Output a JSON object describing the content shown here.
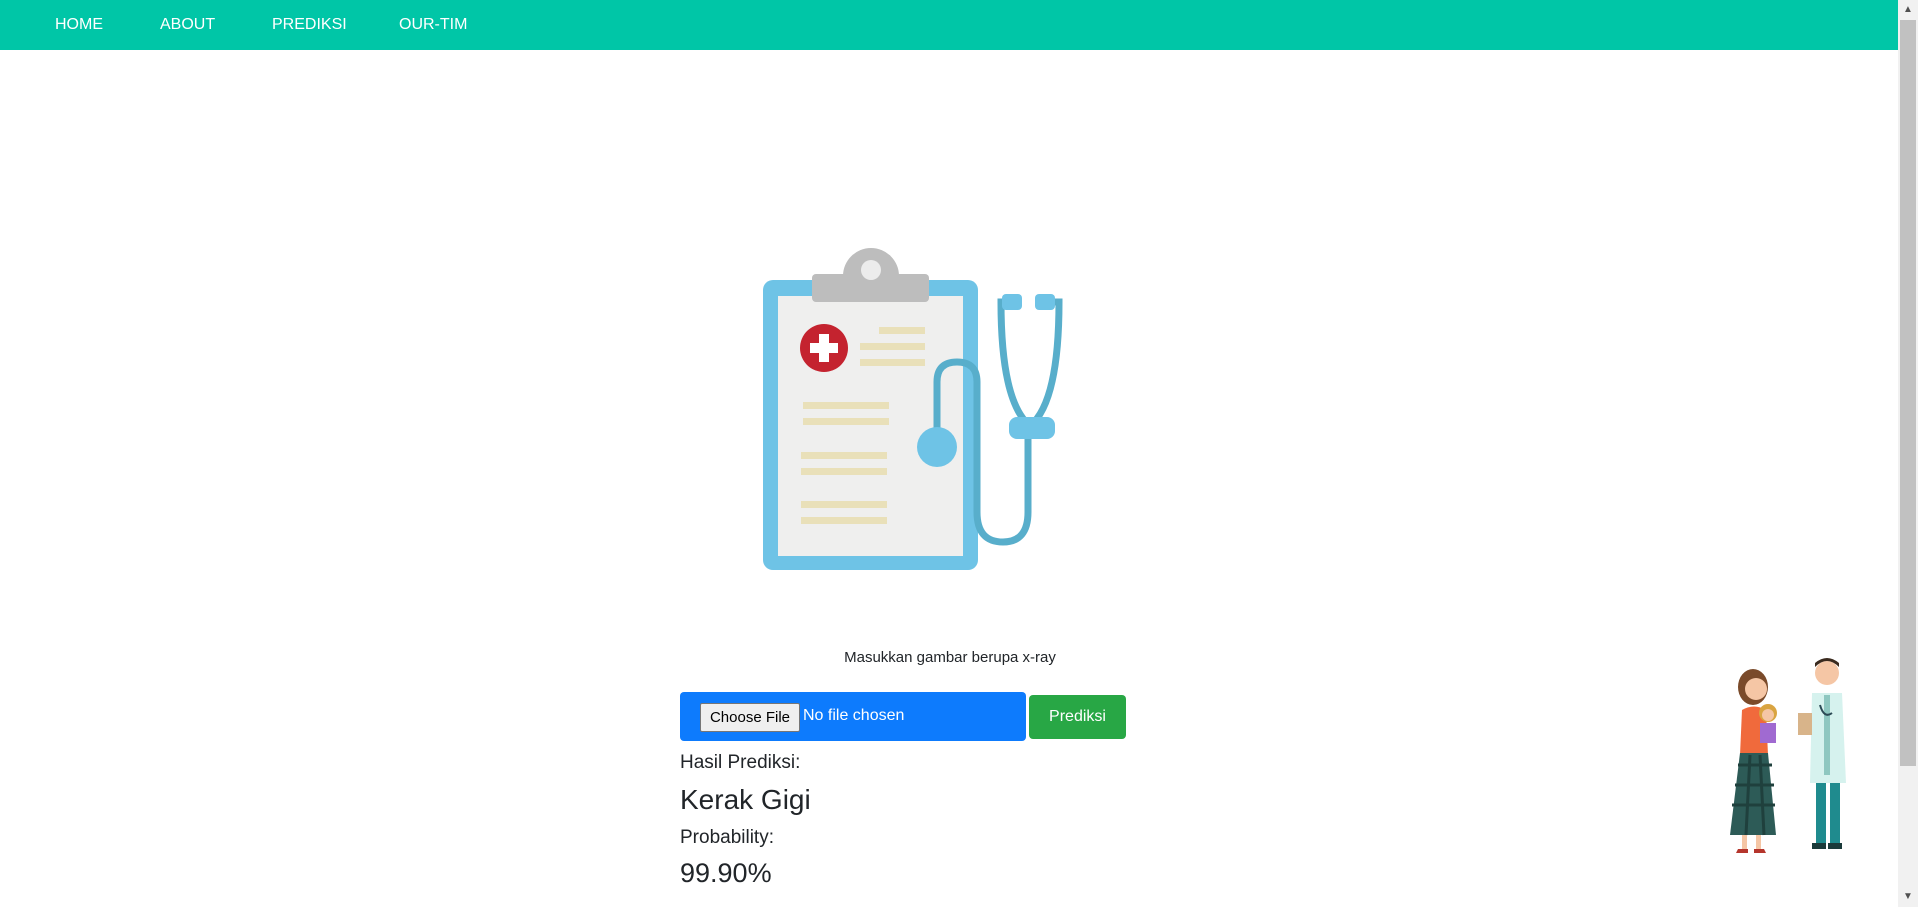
{
  "nav": {
    "items": [
      {
        "label": "HOME"
      },
      {
        "label": "ABOUT"
      },
      {
        "label": "PREDIKSI"
      },
      {
        "label": "OUR-TIM"
      }
    ],
    "background": "#00c6a7"
  },
  "hero": {
    "icon": "clipboard-stethoscope-illustration"
  },
  "upload": {
    "instruction": "Masukkan gambar berupa x-ray",
    "choose_label": "Choose File",
    "file_status": "No file chosen",
    "submit_label": "Prediksi"
  },
  "result": {
    "label": "Hasil Prediksi:",
    "value": "Kerak Gigi",
    "prob_label": "Probability:",
    "prob_value": "99.90%"
  },
  "colors": {
    "primary": "#0d7bfd",
    "success": "#28a745",
    "accent": "#00c6a7"
  }
}
